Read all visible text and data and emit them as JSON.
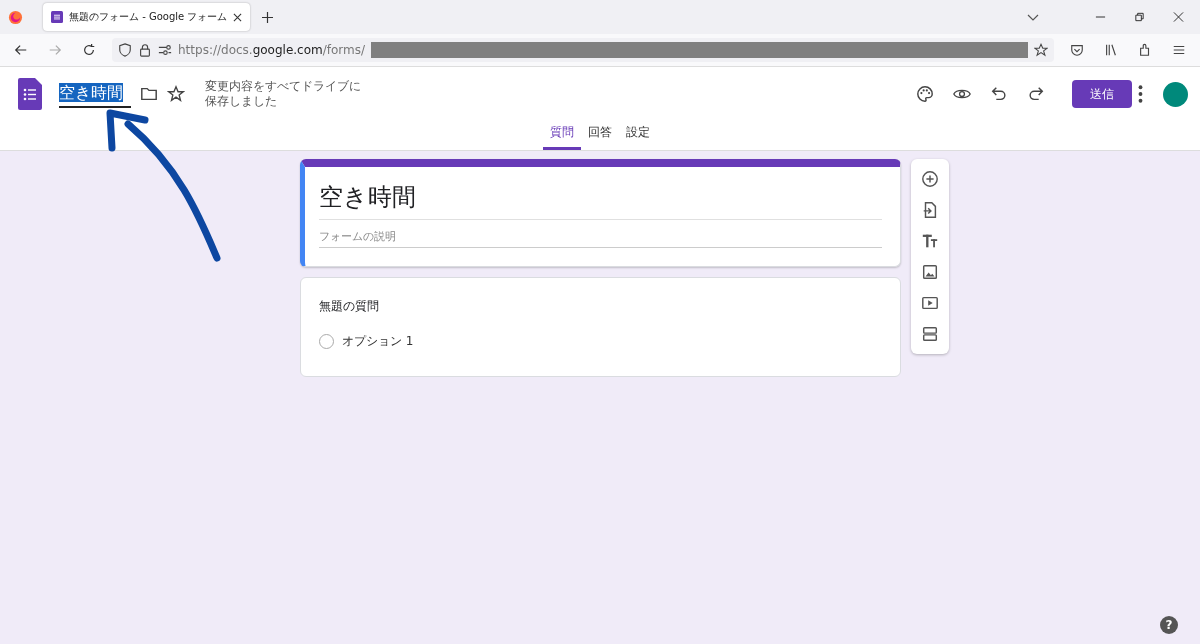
{
  "browser": {
    "tab_title": "無題のフォーム - Google フォーム",
    "url_prefix": "https://docs.",
    "url_domain": "google.com",
    "url_path": "/forms/"
  },
  "header": {
    "doc_title": "空き時間",
    "doc_title_selected": true,
    "save_status": [
      "変更内容をすべてドライブに",
      "保存しました"
    ],
    "send_label": "送信"
  },
  "tabs": [
    {
      "label": "質問",
      "selected": true
    },
    {
      "label": "回答",
      "selected": false
    },
    {
      "label": "設定",
      "selected": false
    }
  ],
  "form": {
    "title": "空き時間",
    "description_placeholder": "フォームの説明"
  },
  "question": {
    "title": "無題の質問",
    "options": [
      {
        "label": "オプション 1",
        "selected": false
      }
    ]
  },
  "help_label": "?"
}
